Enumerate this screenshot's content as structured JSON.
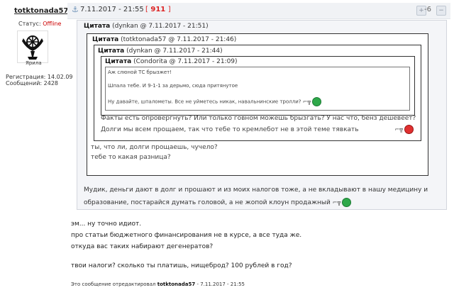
{
  "post": {
    "author": "totktonada57",
    "anchor": "⚓",
    "date": "7.11.2017 - 21:55",
    "number_open": "[",
    "number": "911",
    "number_close": "]",
    "rating": "-6"
  },
  "sidebar": {
    "status_label": "Статус:",
    "status_value": "Offline",
    "avatar_caption": "Ярила",
    "registration_label": "Регистрация:",
    "registration_value": "14.02.09",
    "messages_label": "Сообщений:",
    "messages_value": "2428"
  },
  "quotes": {
    "label": "Цитата",
    "q1_meta": "(dynkan @ 7.11.2017 - 21:51)",
    "q2_meta": "(totktonada57 @ 7.11.2017 - 21:46)",
    "q3_meta": "(dynkan @ 7.11.2017 - 21:44)",
    "q4_meta": "(Condorita @ 7.11.2017 - 21:09)",
    "q5_lines": [
      "Аж слюной ТС брызжет!",
      "Шпала тебе. И 9-1-1 за дерьмо, сюда притянутое",
      "Ну давайте, шпалометы. Все не уйметесь никак, навальнинские тролли?"
    ],
    "q4_lines": [
      "Факты есть опровергнуть? Или только говном можешь брызгать? У нас что, бенз дешевеет?",
      "Долги мы всем прощаем, так что тебе то кремлебот не в этой теме тявкать"
    ],
    "q3_lines": [
      "ты, что ли, долги прощаешь, чучело?",
      "тебе то какая разница?"
    ],
    "q1_lines": [
      "Мудик, деньги дают в долг и прошают и из моих налогов тоже, а не вкладывают в нашу медицину и",
      "образование, постарайся думать головой, а не жопой клоун продажный"
    ]
  },
  "body_lines": [
    "эм... ну точно идиот.",
    "про статьи бюджетного финансирования не в курсе, а все туда же.",
    "откуда вас таких набирают дегенератов?",
    "твои налоги? сколько ты платишь, нищеброд? 100 рублей в год?"
  ],
  "edited": {
    "prefix": "Это сообщение отредактировал",
    "user": "totktonada57",
    "suffix": "- 7.11.2017 - 21:55"
  },
  "icons": [
    "anchor-icon",
    "vote-plus-icon",
    "vote-minus-icon",
    "shooting-smiley-icon"
  ],
  "colors": {
    "offline": "#cc0000",
    "post_number": "#dd2222",
    "quote_bg": "#f4f5f8"
  }
}
